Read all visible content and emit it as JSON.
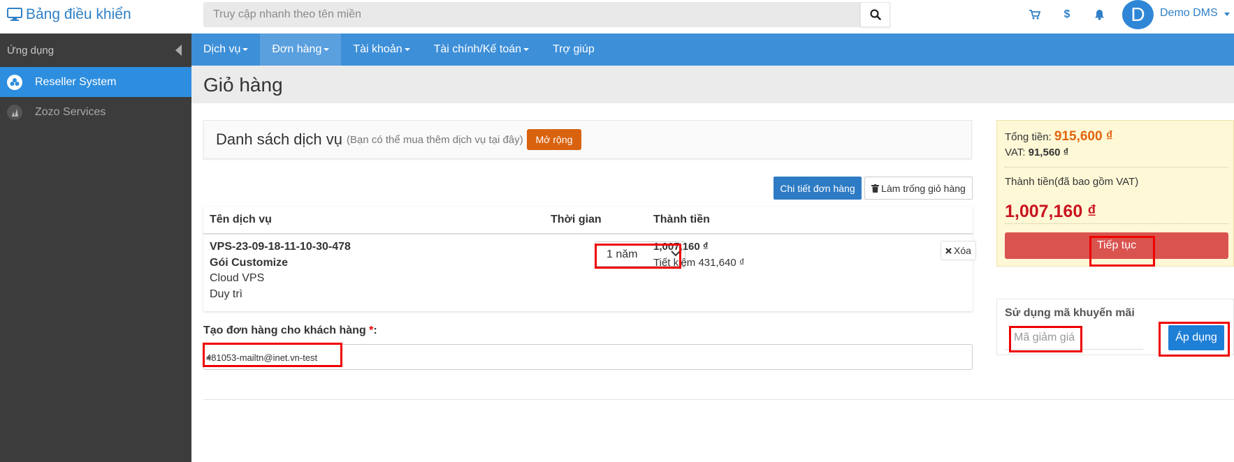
{
  "header": {
    "brand": "Bảng điều khiển",
    "search_placeholder": "Truy cập nhanh theo tên miền",
    "avatar_letter": "D",
    "user_name": "Demo DMS",
    "dollar": "$"
  },
  "sidebar": {
    "title": "Ứng dụng",
    "items": [
      {
        "label": "Reseller System",
        "active": true
      },
      {
        "label": "Zozo Services",
        "active": false
      }
    ]
  },
  "nav": {
    "items": [
      {
        "label": "Dịch vụ",
        "dropdown": true
      },
      {
        "label": "Đơn hàng",
        "dropdown": true
      },
      {
        "label": "Tài khoản",
        "dropdown": true
      },
      {
        "label": "Tài chính/Kế toán",
        "dropdown": true
      },
      {
        "label": "Trợ giúp",
        "dropdown": false
      }
    ]
  },
  "page": {
    "title": "Giỏ hàng"
  },
  "services": {
    "title": "Danh sách dịch vụ",
    "subtitle": "(Bạn có thể mua thêm dịch vụ tại đây)",
    "expand_label": "Mở rộng",
    "detail_button": "Chi tiết đơn hàng",
    "empty_button": "Làm trống giỏ hàng"
  },
  "table": {
    "headers": [
      "Tên dịch vụ",
      "Thời gian",
      "Thành tiền"
    ],
    "row": {
      "name": "VPS-23-09-18-11-10-30-478",
      "package": "Gói Customize",
      "type": "Cloud VPS",
      "action": "Duy trì",
      "duration": "1 năm",
      "price": "1,007,160 ₫",
      "saving": "Tiết kiệm 431,640 ₫",
      "delete_label": "Xóa"
    }
  },
  "customer": {
    "label": "Tạo đơn hàng cho khách hàng",
    "required_mark": "*",
    "colon": ":",
    "value": "481053-mailtn@inet.vn-test"
  },
  "summary": {
    "total_label": "Tổng tiền:",
    "total_value": "915,600 ₫",
    "vat_label": "VAT:",
    "vat_value": "91,560 ₫",
    "grand_label": "Thành tiền(đã bao gồm VAT)",
    "grand_value": "1,007,160 ₫",
    "continue_label": "Tiếp tục"
  },
  "promo": {
    "title": "Sử dụng mã khuyến mãi",
    "placeholder": "Mã giảm giá",
    "apply_label": "Áp dụng"
  },
  "colors": {
    "brand_blue": "#2f80c6",
    "nav_blue": "#3d8fd8",
    "highlight_red": "#ee0000",
    "price_red": "#c9141f",
    "total_orange": "#e06510"
  }
}
